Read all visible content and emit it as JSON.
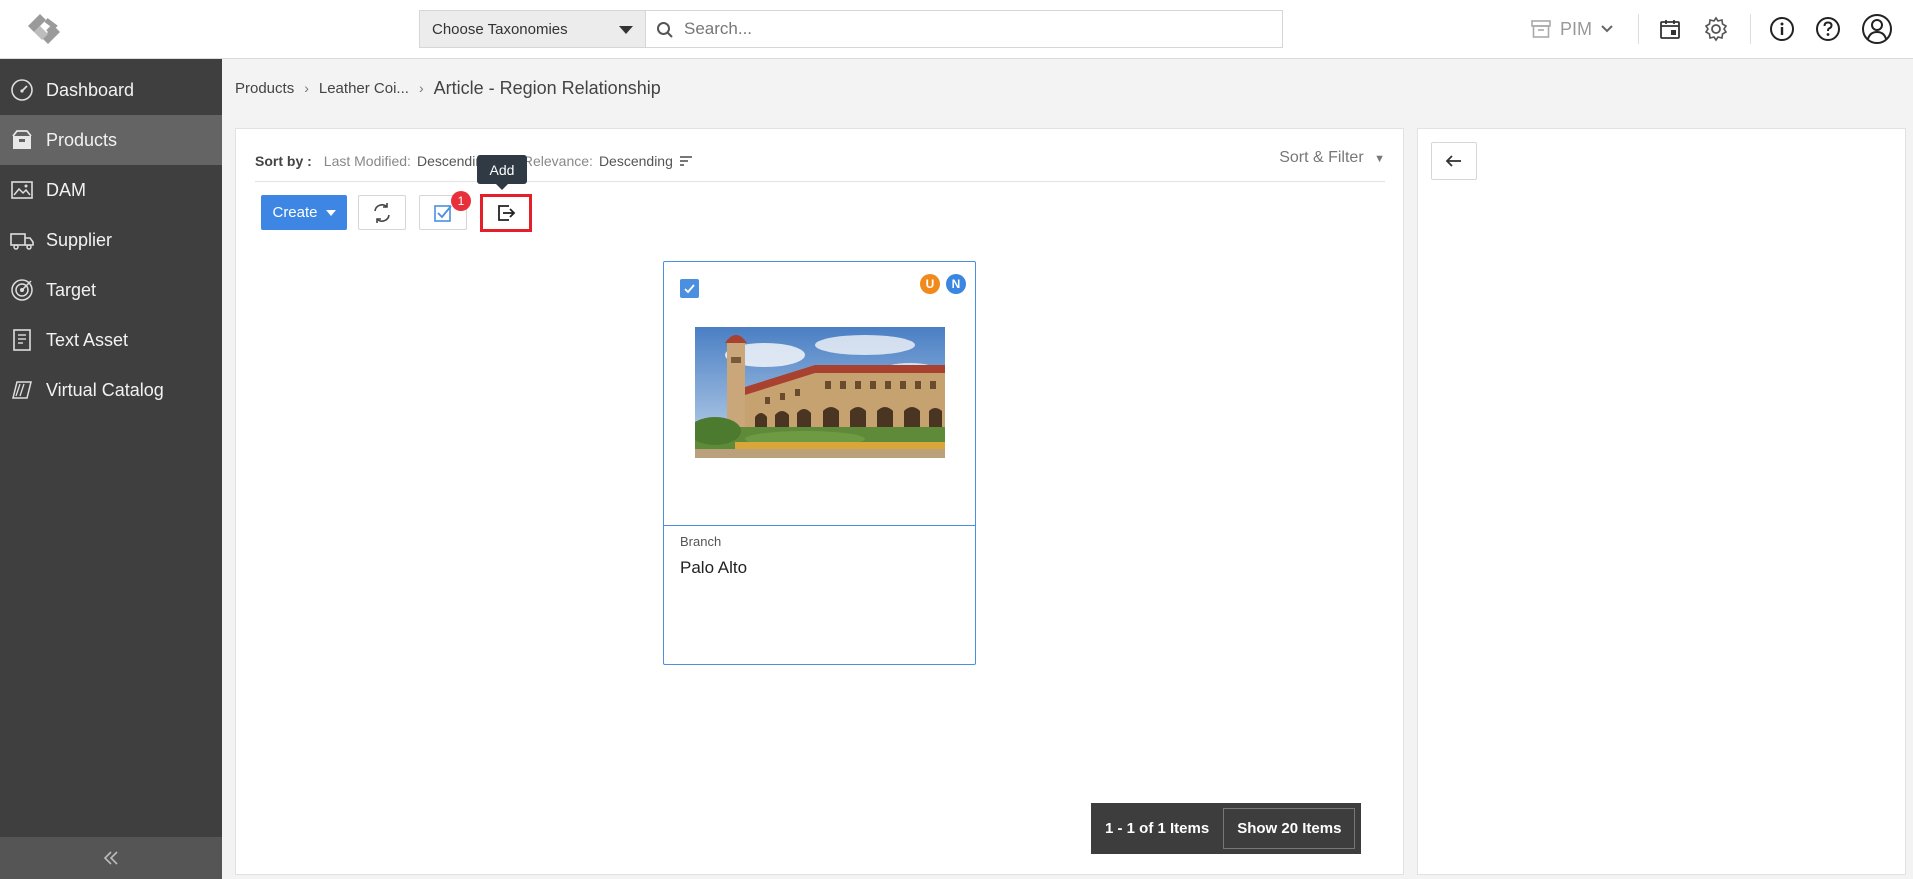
{
  "header": {
    "taxonomy_select": "Choose Taxonomies",
    "search_placeholder": "Search...",
    "app_switcher": "PIM",
    "icons": [
      "logo-icon",
      "calendar-icon",
      "gear-icon",
      "info-icon",
      "help-icon",
      "user-icon"
    ]
  },
  "sidebar": {
    "items": [
      {
        "label": "Dashboard",
        "icon": "gauge-icon"
      },
      {
        "label": "Products",
        "icon": "box-icon",
        "active": true
      },
      {
        "label": "DAM",
        "icon": "image-icon"
      },
      {
        "label": "Supplier",
        "icon": "truck-icon"
      },
      {
        "label": "Target",
        "icon": "target-icon"
      },
      {
        "label": "Text Asset",
        "icon": "document-icon"
      },
      {
        "label": "Virtual Catalog",
        "icon": "catalog-icon"
      }
    ]
  },
  "breadcrumb": {
    "items": [
      "Products",
      "Leather Coi..."
    ],
    "current": "Article - Region Relationship"
  },
  "sortbar": {
    "label": "Sort by :",
    "fields": [
      {
        "key": "Last Modified:",
        "value": "Descending"
      },
      {
        "key": "Relevance:",
        "value": "Descending"
      }
    ],
    "sort_filter": "Sort & Filter"
  },
  "toolbar": {
    "create_label": "Create",
    "selected_badge": "1",
    "tooltip": "Add"
  },
  "cards": [
    {
      "type": "Branch",
      "name": "Palo Alto",
      "checked": true,
      "badges": [
        {
          "letter": "U",
          "color": "#f08a1c"
        },
        {
          "letter": "N",
          "color": "#3b86e0"
        }
      ]
    }
  ],
  "pagination": {
    "count": "1 - 1 of 1 Items",
    "show": "Show 20 Items"
  }
}
